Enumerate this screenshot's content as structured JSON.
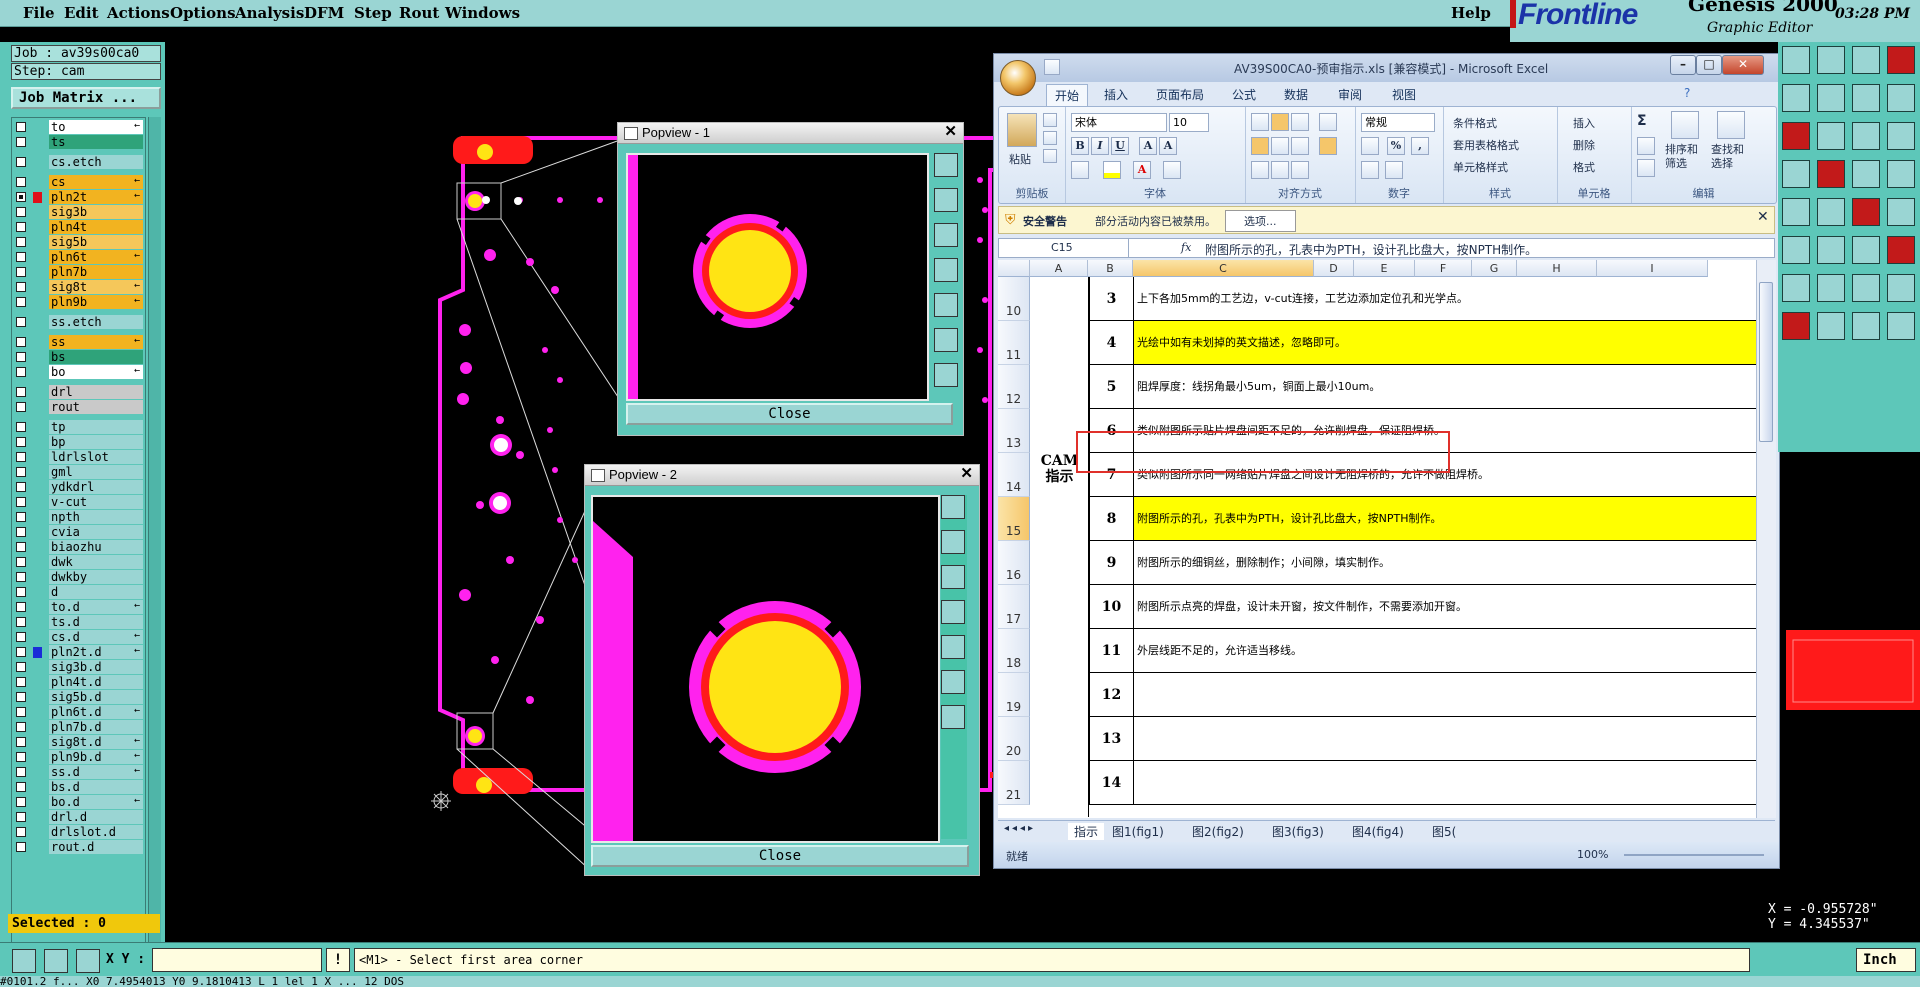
{
  "menubar": {
    "items": [
      "File",
      "Edit",
      "Actions",
      "Options",
      "Analysis",
      "DFM",
      "Step",
      "Rout",
      "Windows"
    ],
    "help": "Help"
  },
  "brand": {
    "logo_text": "Frontline",
    "product": "Genesis 2000",
    "subtitle": "Graphic Editor",
    "time": "03:28 PM"
  },
  "left_panel": {
    "job": "Job : av39s00ca0",
    "step": "Step: cam",
    "job_matrix": "Job Matrix ...",
    "selected": "Selected : 0"
  },
  "layers": [
    {
      "name": "to",
      "bg": "#ffffff",
      "arrow": "←"
    },
    {
      "name": "ts",
      "bg": "#2fa37a",
      "arrow": ""
    },
    {
      "sep": true
    },
    {
      "name": "cs.etch",
      "bg": "#9ad5d3",
      "arrow": ""
    },
    {
      "sep": true
    },
    {
      "name": "cs",
      "bg": "#f2b320",
      "arrow": "←"
    },
    {
      "name": "pln2t",
      "bg": "#f2b320",
      "arrow": "←",
      "active": true,
      "color": "#e0101a"
    },
    {
      "name": "sig3b",
      "bg": "#f5c75a",
      "arrow": ""
    },
    {
      "name": "pln4t",
      "bg": "#f2b320",
      "arrow": ""
    },
    {
      "name": "sig5b",
      "bg": "#f5c75a",
      "arrow": ""
    },
    {
      "name": "pln6t",
      "bg": "#f2b320",
      "arrow": "←"
    },
    {
      "name": "pln7b",
      "bg": "#f2b320",
      "arrow": ""
    },
    {
      "name": "sig8t",
      "bg": "#f5c75a",
      "arrow": "←"
    },
    {
      "name": "pln9b",
      "bg": "#f2b320",
      "arrow": "←"
    },
    {
      "sep": true
    },
    {
      "name": "ss.etch",
      "bg": "#9ad5d3",
      "arrow": ""
    },
    {
      "sep": true
    },
    {
      "name": "ss",
      "bg": "#f2b320",
      "arrow": "←"
    },
    {
      "name": "bs",
      "bg": "#2fa37a",
      "arrow": ""
    },
    {
      "name": "bo",
      "bg": "#ffffff",
      "arrow": "←"
    },
    {
      "sep": true
    },
    {
      "name": "drl",
      "bg": "#c9c9c9",
      "arrow": ""
    },
    {
      "name": "rout",
      "bg": "#c9c9c9",
      "arrow": ""
    },
    {
      "sep": true
    },
    {
      "name": "tp",
      "bg": "#9ad5d3",
      "arrow": ""
    },
    {
      "name": "bp",
      "bg": "#9ad5d3",
      "arrow": ""
    },
    {
      "name": "ldrlslot",
      "bg": "#9ad5d3",
      "arrow": ""
    },
    {
      "name": "gml",
      "bg": "#9ad5d3",
      "arrow": ""
    },
    {
      "name": "ydkdrl",
      "bg": "#9ad5d3",
      "arrow": ""
    },
    {
      "name": "v-cut",
      "bg": "#9ad5d3",
      "arrow": ""
    },
    {
      "name": "npth",
      "bg": "#9ad5d3",
      "arrow": ""
    },
    {
      "name": "cvia",
      "bg": "#9ad5d3",
      "arrow": ""
    },
    {
      "name": "biaozhu",
      "bg": "#9ad5d3",
      "arrow": ""
    },
    {
      "name": "dwk",
      "bg": "#9ad5d3",
      "arrow": ""
    },
    {
      "name": "dwkby",
      "bg": "#9ad5d3",
      "arrow": ""
    },
    {
      "name": "d",
      "bg": "#9ad5d3",
      "arrow": ""
    },
    {
      "name": "to.d",
      "bg": "#9ad5d3",
      "arrow": "←"
    },
    {
      "name": "ts.d",
      "bg": "#9ad5d3",
      "arrow": ""
    },
    {
      "name": "cs.d",
      "bg": "#9ad5d3",
      "arrow": "←"
    },
    {
      "name": "pln2t.d",
      "bg": "#9ad5d3",
      "arrow": "←",
      "color": "#1a2cd8"
    },
    {
      "name": "sig3b.d",
      "bg": "#9ad5d3",
      "arrow": ""
    },
    {
      "name": "pln4t.d",
      "bg": "#9ad5d3",
      "arrow": ""
    },
    {
      "name": "sig5b.d",
      "bg": "#9ad5d3",
      "arrow": ""
    },
    {
      "name": "pln6t.d",
      "bg": "#9ad5d3",
      "arrow": "←"
    },
    {
      "name": "pln7b.d",
      "bg": "#9ad5d3",
      "arrow": ""
    },
    {
      "name": "sig8t.d",
      "bg": "#9ad5d3",
      "arrow": "←"
    },
    {
      "name": "pln9b.d",
      "bg": "#9ad5d3",
      "arrow": "←"
    },
    {
      "name": "ss.d",
      "bg": "#9ad5d3",
      "arrow": "←"
    },
    {
      "name": "bs.d",
      "bg": "#9ad5d3",
      "arrow": ""
    },
    {
      "name": "bo.d",
      "bg": "#9ad5d3",
      "arrow": "←"
    },
    {
      "name": "drl.d",
      "bg": "#9ad5d3",
      "arrow": ""
    },
    {
      "name": "drlslot.d",
      "bg": "#9ad5d3",
      "arrow": ""
    },
    {
      "name": "rout.d",
      "bg": "#9ad5d3",
      "arrow": ""
    }
  ],
  "popview1": {
    "title": "Popview - 1",
    "close": "Close"
  },
  "popview2": {
    "title": "Popview - 2",
    "close": "Close"
  },
  "excel": {
    "title": "AV39S00CA0-预审指示.xls  [兼容模式]  - Microsoft Excel",
    "tabs": [
      "开始",
      "插入",
      "页面布局",
      "公式",
      "数据",
      "审阅",
      "视图"
    ],
    "font_name": "宋体",
    "font_size": "10",
    "number_format": "常规",
    "paste": "粘贴",
    "styles": [
      "条件格式",
      "套用表格格式",
      "单元格样式"
    ],
    "cells_cmds": [
      "插入",
      "删除",
      "格式"
    ],
    "sum": "Σ",
    "sort": "排序和\n筛选",
    "find": "查找和\n选择",
    "groups": [
      "剪贴板",
      "字体",
      "对齐方式",
      "数字",
      "样式",
      "单元格",
      "编辑"
    ],
    "security_label": "安全警告",
    "security_text": "部分活动内容已被禁用。",
    "security_btn": "选项...",
    "namebox": "C15",
    "fx": "fx",
    "formula": "附图所示的孔，孔表中为PTH，设计孔比盘大，按NPTH制作。",
    "columns": [
      "A",
      "B",
      "C",
      "D",
      "E",
      "F",
      "G",
      "H",
      "I"
    ],
    "cam_label": "CAM\n指示",
    "rows": [
      {
        "row": "10",
        "num": "3",
        "text": "上下各加5mm的工艺边，v-cut连接，工艺边添加定位孔和光学点。",
        "hl": false
      },
      {
        "row": "11",
        "num": "4",
        "text": "光绘中如有未划掉的英文描述，忽略即可。",
        "hl": true
      },
      {
        "row": "12",
        "num": "5",
        "text": "阻焊厚度：线拐角最小5um，铜面上最小10um。",
        "hl": false
      },
      {
        "row": "13",
        "num": "6",
        "text": "类似附图所示贴片焊盘间距不足的，允许削焊盘，保证阻焊桥。",
        "hl": false
      },
      {
        "row": "14",
        "num": "7",
        "text": "类似附图所示同一网络贴片焊盘之间设计无阻焊桥的，允许不做阻焊桥。",
        "hl": false
      },
      {
        "row": "15",
        "num": "8",
        "text": "附图所示的孔，孔表中为PTH，设计孔比盘大，按NPTH制作。",
        "hl": true
      },
      {
        "row": "16",
        "num": "9",
        "text": "附图所示的细铜丝，删除制作；小间隙，填实制作。",
        "hl": false
      },
      {
        "row": "17",
        "num": "10",
        "text": "附图所示点亮的焊盘，设计未开窗，按文件制作，不需要添加开窗。",
        "hl": false
      },
      {
        "row": "18",
        "num": "11",
        "text": "外层线距不足的，允许适当移线。",
        "hl": false
      },
      {
        "row": "19",
        "num": "12",
        "text": "",
        "hl": false
      },
      {
        "row": "20",
        "num": "13",
        "text": "",
        "hl": false
      },
      {
        "row": "21",
        "num": "14",
        "text": "",
        "hl": false
      }
    ],
    "sheet_tabs": [
      "指示",
      "图1(fig1)",
      "图2(fig2)",
      "图3(fig3)",
      "图4(fig4)",
      "图5("
    ],
    "status_ready": "就绪",
    "zoom": "100%"
  },
  "coords": {
    "x": "X = -0.955728\"",
    "y": "Y =  4.345537\""
  },
  "bottom": {
    "xy_label": "X Y :",
    "prompt": "<M1> - Select first area corner",
    "units": "Inch",
    "status_line": "#0101.2 f... X0 7.4954013 Y0 9.1810413  L  1  lel  1  X ... 12 DOS"
  },
  "colors": {
    "genesis_teal": "#5dc7b9",
    "board_red": "#ff1a1a",
    "pad_yellow": "#ffe414",
    "mask_magenta": "#ff22ee",
    "highlight_yellow": "#ffff00",
    "selection_red": "#e0302a"
  }
}
